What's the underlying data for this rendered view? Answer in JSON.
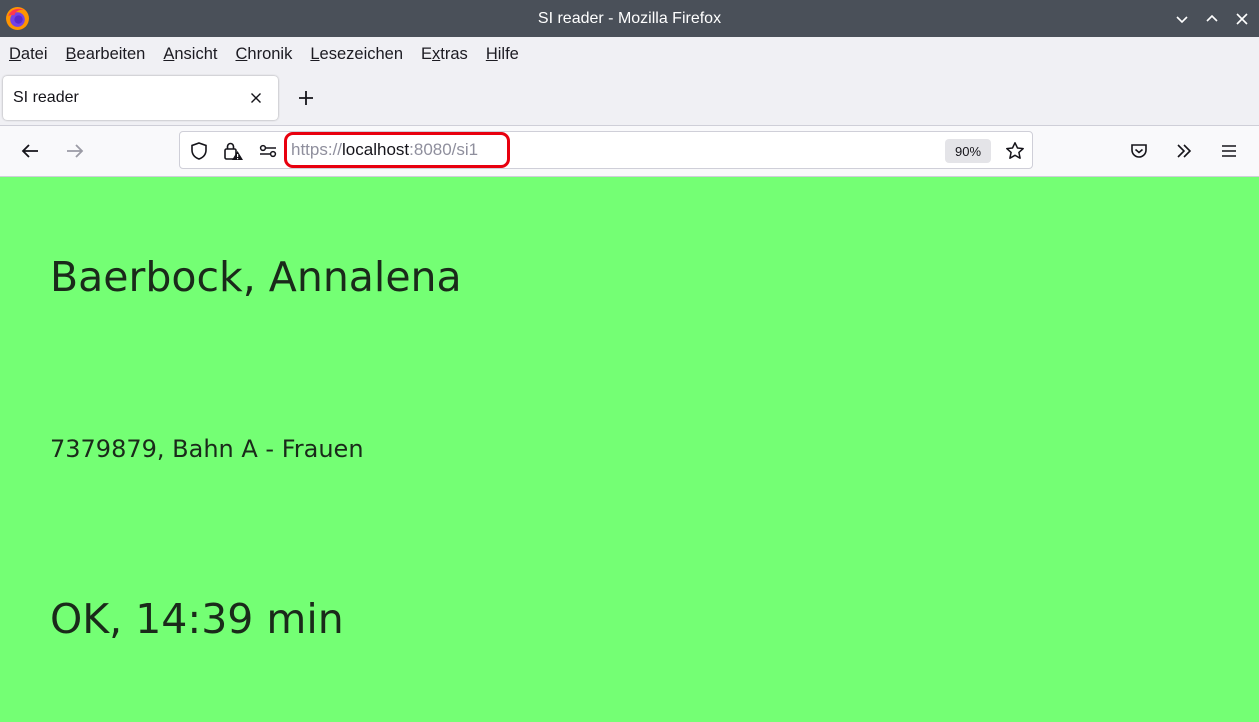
{
  "window": {
    "title": "SI reader - Mozilla Firefox"
  },
  "menu": {
    "items": [
      {
        "accel": "D",
        "rest": "atei"
      },
      {
        "accel": "B",
        "rest": "earbeiten"
      },
      {
        "accel": "A",
        "rest": "nsicht"
      },
      {
        "accel": "C",
        "rest": "hronik"
      },
      {
        "accel": "L",
        "rest": "esezeichen"
      },
      {
        "pre": "E",
        "accel": "x",
        "rest": "tras"
      },
      {
        "accel": "H",
        "rest": "ilfe"
      }
    ]
  },
  "tab": {
    "title": "SI reader"
  },
  "urlbar": {
    "scheme": "https://",
    "host": "localhost",
    "rest": ":8080/si1",
    "zoom": "90%"
  },
  "page": {
    "name": "Baerbock, Annalena",
    "info": "7379879, Bahn A - Frauen",
    "result": "OK, 14:39 min",
    "background_color": "#74ff74"
  },
  "icons": {
    "titlebar": [
      "firefox-logo-icon",
      "minimize-icon",
      "maximize-icon",
      "close-icon"
    ],
    "nav": [
      "back-arrow-icon",
      "forward-arrow-icon",
      "shield-icon",
      "lock-warning-icon",
      "permissions-icon",
      "bookmark-star-icon",
      "pocket-icon",
      "overflow-chevron-icon",
      "hamburger-menu-icon"
    ]
  }
}
